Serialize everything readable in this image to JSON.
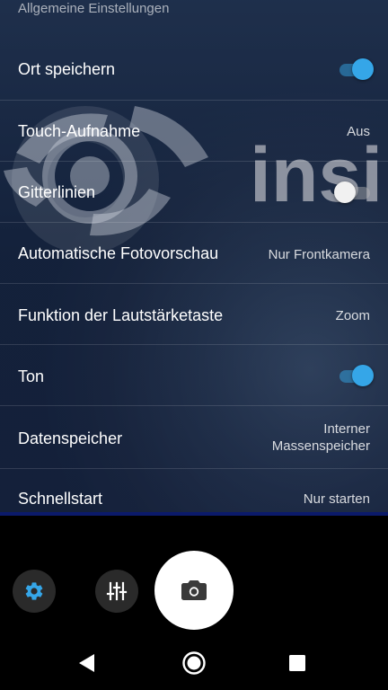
{
  "settings": {
    "section_header": "Allgemeine Einstellungen",
    "rows": [
      {
        "label": "Ort speichern",
        "type": "toggle",
        "state": "on"
      },
      {
        "label": "Touch-Aufnahme",
        "type": "value",
        "value": "Aus"
      },
      {
        "label": "Gitterlinien",
        "type": "toggle",
        "state": "off"
      },
      {
        "label": "Automatische Fotovorschau",
        "type": "value",
        "value": "Nur Frontkamera"
      },
      {
        "label": "Funktion der Lautstärketaste",
        "type": "value",
        "value": "Zoom"
      },
      {
        "label": "Ton",
        "type": "toggle",
        "state": "on"
      },
      {
        "label": "Datenspeicher",
        "type": "value",
        "value_line1": "Interner",
        "value_line2": "Massenspeicher"
      },
      {
        "label": "Schnellstart",
        "type": "value",
        "value": "Nur starten"
      }
    ]
  },
  "viewfinder": {
    "watermark_text": "insi"
  },
  "controls": {
    "settings_icon": "gear-icon",
    "manual_icon": "sliders-icon",
    "shutter_icon": "camera-icon"
  },
  "navigation": {
    "back_icon": "back-triangle-icon",
    "home_icon": "home-circle-icon",
    "recents_icon": "recents-square-icon"
  },
  "colors": {
    "accent": "#35a6e8",
    "toggle_off_thumb": "#f1f1f1",
    "panel_background": "#1b2740",
    "bar_background": "#000000"
  }
}
